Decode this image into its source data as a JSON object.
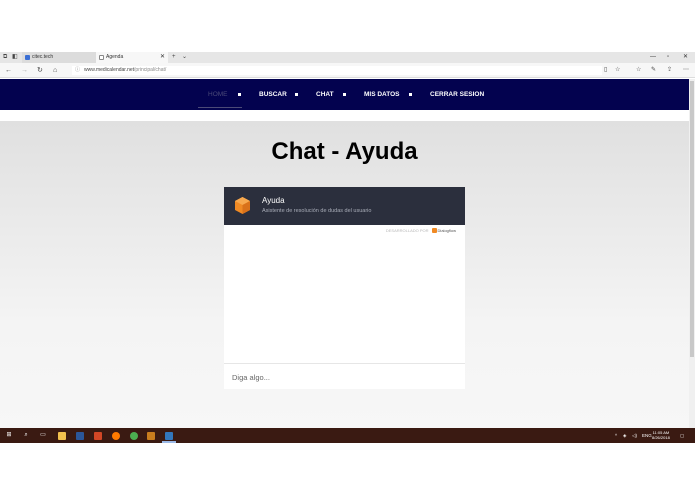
{
  "browser": {
    "tabs": [
      {
        "label": "citec.tech",
        "favicon_color": "#3b6fd4",
        "active": false
      },
      {
        "label": "Agenda",
        "favicon_color": "#888888",
        "active": true
      }
    ],
    "new_tab_label": "+",
    "tab_list_label": "⌄",
    "address": {
      "host": "www.medicalendar.net",
      "path": "/principal/chat/"
    }
  },
  "site_nav": {
    "items": [
      {
        "label": "HOME"
      },
      {
        "label": "BUSCAR"
      },
      {
        "label": "CHAT"
      },
      {
        "label": "MIS DATOS"
      },
      {
        "label": "CERRAR SESION"
      }
    ]
  },
  "page": {
    "title": "Chat - Ayuda"
  },
  "chat": {
    "agent_name": "Ayuda",
    "agent_description": "Asistente de resolución de dudas del usuario",
    "powered_by": "DESARROLLADO POR",
    "powered_brand": "Dialogflow",
    "input_placeholder": "Diga algo...",
    "logo_color": "#f08a24"
  },
  "taskbar": {
    "apps": [
      {
        "name": "file-explorer",
        "color": "#f2c14e"
      },
      {
        "name": "word",
        "color": "#2b579a"
      },
      {
        "name": "powerpoint",
        "color": "#d24726"
      },
      {
        "name": "firefox",
        "color": "#ff7a00"
      },
      {
        "name": "chrome",
        "color": "#4caf50"
      },
      {
        "name": "sublime",
        "color": "#c97d1e"
      },
      {
        "name": "edge",
        "color": "#3277bc"
      }
    ],
    "language": "ENG",
    "time": "11:05 AM",
    "date": "8/26/2018"
  },
  "colors": {
    "nav_bg": "#03024f",
    "chat_header_bg": "#2b2f3d",
    "taskbar_bg": "#3a1a12"
  }
}
